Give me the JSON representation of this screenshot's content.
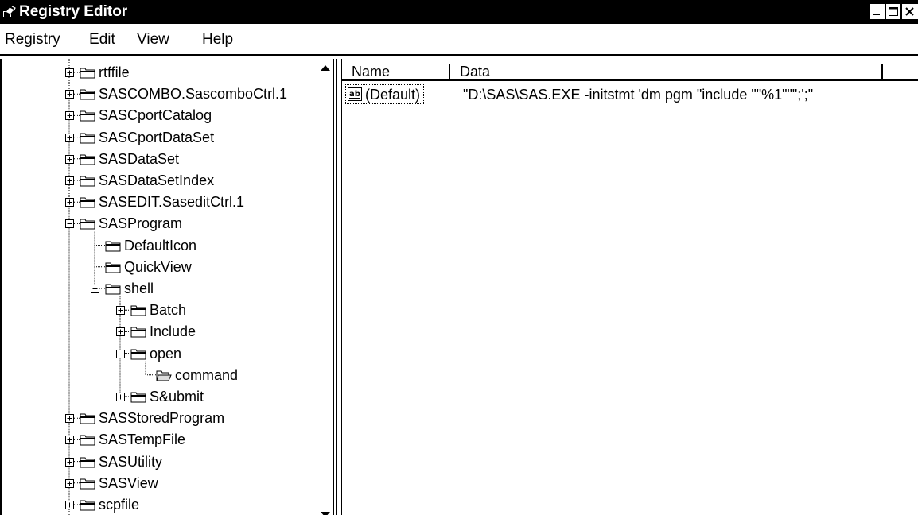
{
  "window": {
    "title": "Registry Editor",
    "icon": "registry-editor-icon"
  },
  "menu": [
    {
      "label": "Registry",
      "mnemonic_index": 0
    },
    {
      "label": "Edit",
      "mnemonic_index": 0
    },
    {
      "label": "View",
      "mnemonic_index": 0
    },
    {
      "label": "Help",
      "mnemonic_index": 0
    }
  ],
  "tree": {
    "items": [
      {
        "label": "rtffile",
        "expander": "plus",
        "open": false
      },
      {
        "label": "SASCOMBO.SascomboCtrl.1",
        "expander": "plus",
        "open": false
      },
      {
        "label": "SASCportCatalog",
        "expander": "plus",
        "open": false
      },
      {
        "label": "SASCportDataSet",
        "expander": "plus",
        "open": false
      },
      {
        "label": "SASDataSet",
        "expander": "plus",
        "open": false
      },
      {
        "label": "SASDataSetIndex",
        "expander": "plus",
        "open": false
      },
      {
        "label": "SASEDIT.SaseditCtrl.1",
        "expander": "plus",
        "open": false
      },
      {
        "label": "SASProgram",
        "expander": "minus",
        "open": false
      },
      {
        "label": "DefaultIcon",
        "expander": "none",
        "open": false
      },
      {
        "label": "QuickView",
        "expander": "none",
        "open": false
      },
      {
        "label": "shell",
        "expander": "minus",
        "open": false
      },
      {
        "label": "Batch",
        "expander": "plus",
        "open": false
      },
      {
        "label": "Include",
        "expander": "plus",
        "open": false
      },
      {
        "label": "open",
        "expander": "minus",
        "open": false
      },
      {
        "label": "command",
        "expander": "none",
        "open": true
      },
      {
        "label": "S&ubmit",
        "expander": "plus",
        "open": false
      },
      {
        "label": "SASStoredProgram",
        "expander": "plus",
        "open": false
      },
      {
        "label": "SASTempFile",
        "expander": "plus",
        "open": false
      },
      {
        "label": "SASUtility",
        "expander": "plus",
        "open": false
      },
      {
        "label": "SASView",
        "expander": "plus",
        "open": false
      },
      {
        "label": "scpfile",
        "expander": "plus",
        "open": false
      }
    ]
  },
  "list": {
    "columns": [
      "Name",
      "Data"
    ],
    "rows": [
      {
        "icon": "string-value-icon",
        "name": "(Default)",
        "data": "\"D:\\SAS\\SAS.EXE -initstmt 'dm pgm \"include \"\"%1\"\"\";';\""
      }
    ]
  }
}
